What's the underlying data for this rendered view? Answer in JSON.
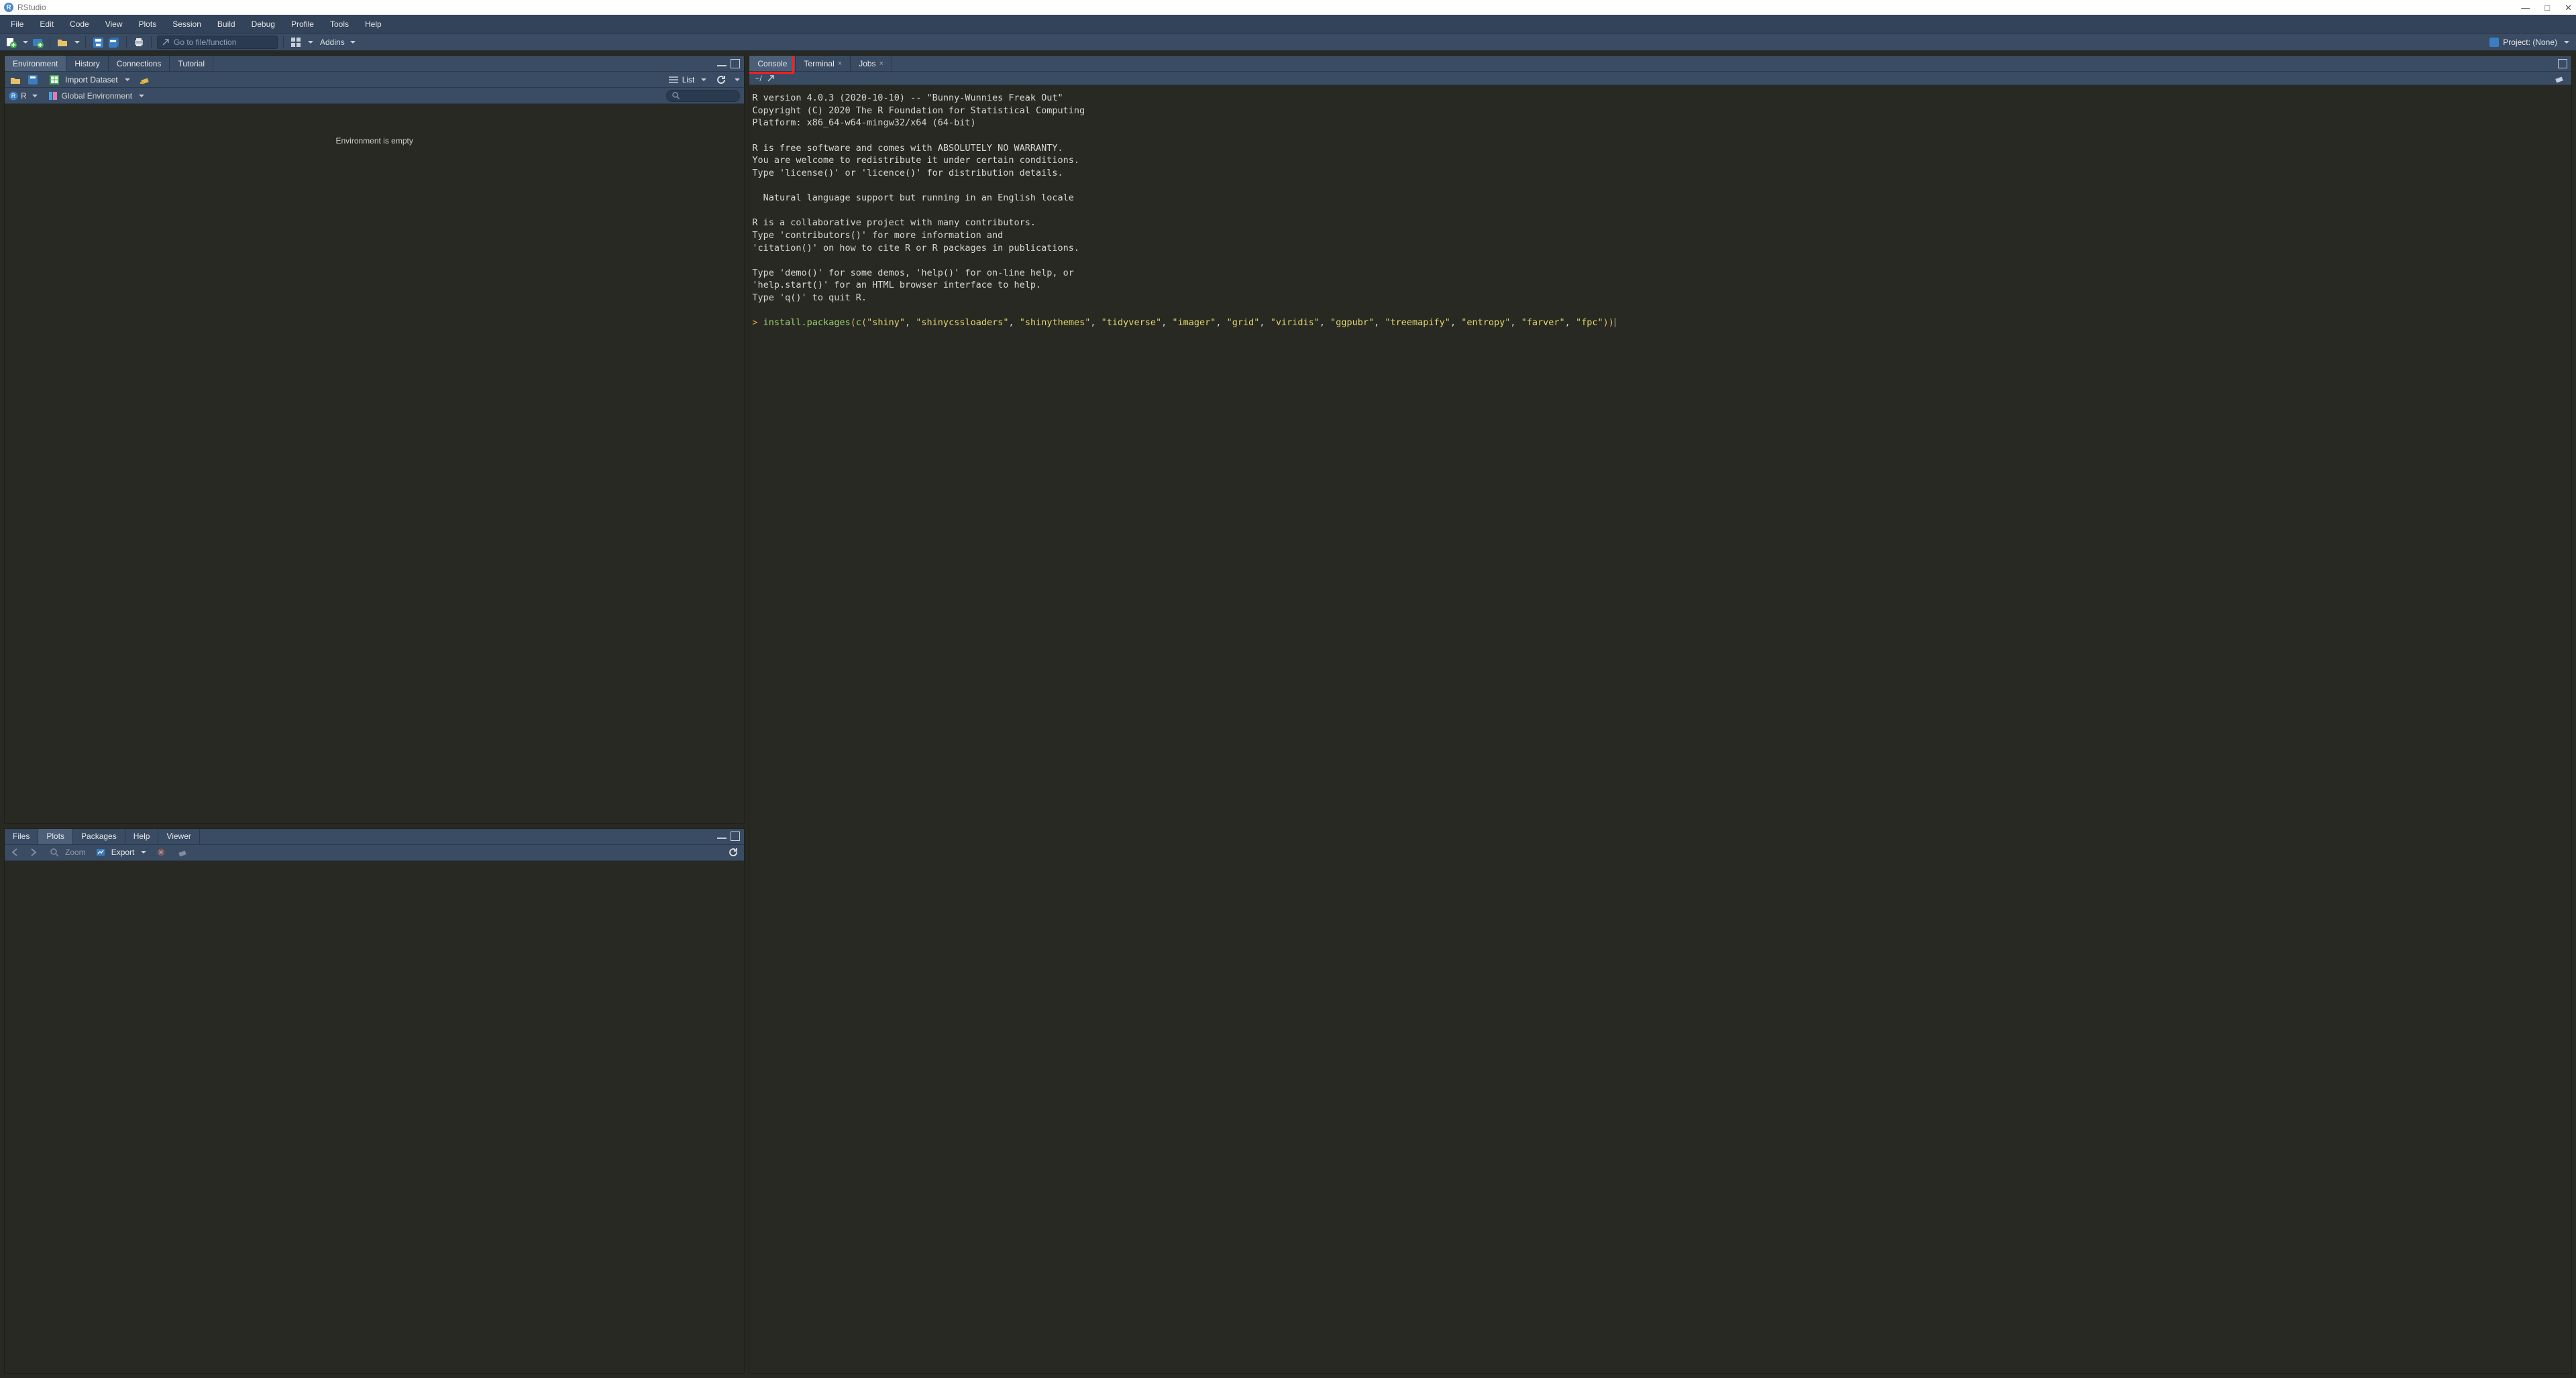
{
  "window": {
    "title": "RStudio"
  },
  "menu": {
    "items": [
      "File",
      "Edit",
      "Code",
      "View",
      "Plots",
      "Session",
      "Build",
      "Debug",
      "Profile",
      "Tools",
      "Help"
    ]
  },
  "toolbar": {
    "goto_placeholder": "Go to file/function",
    "addins_label": "Addins",
    "project_label": "Project: (None)"
  },
  "env_pane": {
    "tabs": [
      "Environment",
      "History",
      "Connections",
      "Tutorial"
    ],
    "active_tab": 0,
    "import_label": "Import Dataset",
    "list_label": "List",
    "scope_prefix": "R",
    "scope_label": "Global Environment",
    "empty_text": "Environment is empty"
  },
  "plots_pane": {
    "tabs": [
      "Files",
      "Plots",
      "Packages",
      "Help",
      "Viewer"
    ],
    "active_tab": 1,
    "zoom_label": "Zoom",
    "export_label": "Export"
  },
  "console_pane": {
    "tabs": [
      "Console",
      "Terminal",
      "Jobs"
    ],
    "active_tab": 0,
    "cwd": "~/",
    "banner": "R version 4.0.3 (2020-10-10) -- \"Bunny-Wunnies Freak Out\"\nCopyright (C) 2020 The R Foundation for Statistical Computing\nPlatform: x86_64-w64-mingw32/x64 (64-bit)\n\nR is free software and comes with ABSOLUTELY NO WARRANTY.\nYou are welcome to redistribute it under certain conditions.\nType 'license()' or 'licence()' for distribution details.\n\n  Natural language support but running in an English locale\n\nR is a collaborative project with many contributors.\nType 'contributors()' for more information and\n'citation()' on how to cite R or R packages in publications.\n\nType 'demo()' for some demos, 'help()' for on-line help, or\n'help.start()' for an HTML browser interface to help.\nType 'q()' to quit R.\n",
    "input": {
      "fn": "install.packages",
      "inner_fn": "c",
      "args": [
        "shiny",
        "shinycssloaders",
        "shinythemes",
        "tidyverse",
        "imager",
        "grid",
        "viridis",
        "ggpubr",
        "treemapify",
        "entropy",
        "farver",
        "fpc"
      ]
    }
  }
}
